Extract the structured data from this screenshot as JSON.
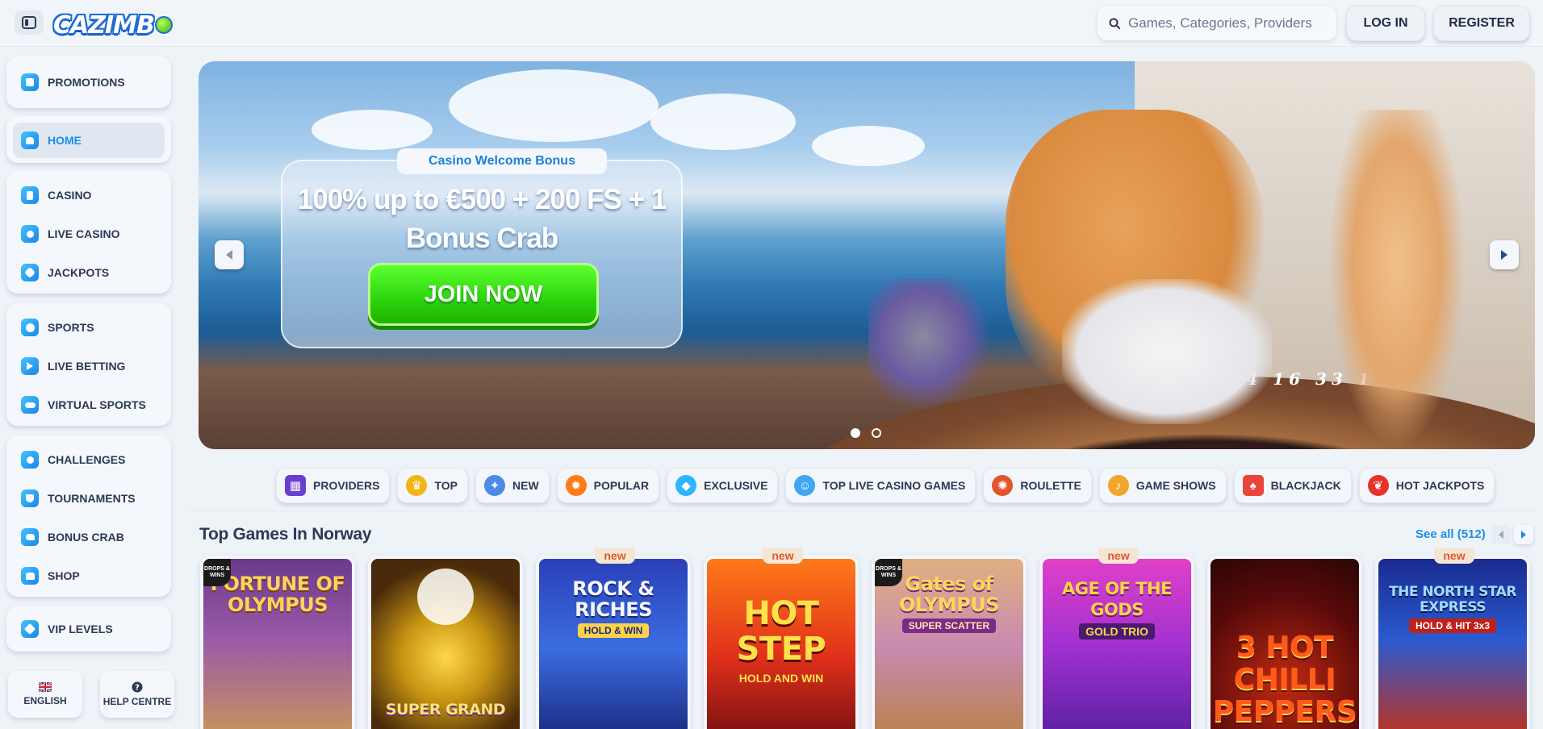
{
  "header": {
    "logo_text": "CAZIMB",
    "search_placeholder": "Games, Categories, Providers",
    "login_label": "LOG IN",
    "register_label": "REGISTER"
  },
  "sidebar": {
    "promotions": "PROMOTIONS",
    "home": "HOME",
    "casino": "CASINO",
    "live_casino": "LIVE CASINO",
    "jackpots": "JACKPOTS",
    "sports": "SPORTS",
    "live_betting": "LIVE BETTING",
    "virtual_sports": "VIRTUAL SPORTS",
    "challenges": "CHALLENGES",
    "tournaments": "TOURNAMENTS",
    "bonus_crab": "BONUS CRAB",
    "shop": "SHOP",
    "vip_levels": "VIP LEVELS",
    "language": "ENGLISH",
    "help": "HELP CENTRE"
  },
  "hero": {
    "tag": "Casino Welcome Bonus",
    "headline": "100% up to €500 + 200 FS + 1 Bonus Crab",
    "cta": "JOIN NOW",
    "roulette_numbers": "23 10 5 24 16 33 1",
    "slide_count": 2,
    "active_slide": 1
  },
  "categories": {
    "providers": "PROVIDERS",
    "top": "TOP",
    "new": "NEW",
    "popular": "POPULAR",
    "exclusive": "EXCLUSIVE",
    "top_live": "TOP LIVE CASINO GAMES",
    "roulette": "ROULETTE",
    "game_shows": "GAME SHOWS",
    "blackjack": "BLACKJACK",
    "hot_jackpots": "HOT JACKPOTS"
  },
  "top_games": {
    "title": "Top Games In Norway",
    "see_all": "See all (512)",
    "new_badge": "new",
    "drops_badge": "DROPS & WINS",
    "games": [
      {
        "title": "FORTUNE OF OLYMPUS",
        "sub": "",
        "is_new": false,
        "drops": true
      },
      {
        "title": "SUPER GRAND",
        "sub": "",
        "is_new": false,
        "drops": false
      },
      {
        "title": "ROCK & RICHES",
        "sub": "HOLD & WIN",
        "is_new": true,
        "drops": false
      },
      {
        "title": "HOT STEP",
        "sub": "HOLD AND WIN",
        "is_new": true,
        "drops": false
      },
      {
        "title": "Gates of OLYMPUS",
        "sub": "SUPER SCATTER",
        "is_new": false,
        "drops": true
      },
      {
        "title": "AGE OF THE GODS",
        "sub": "GOLD TRIO",
        "is_new": true,
        "drops": false
      },
      {
        "title": "3 HOT CHILLI PEPPERS",
        "sub": "",
        "is_new": false,
        "drops": false
      },
      {
        "title": "THE NORTH STAR EXPRESS",
        "sub": "HOLD & HIT 3x3",
        "is_new": true,
        "drops": false
      }
    ]
  },
  "colors": {
    "accent": "#1d8ee8",
    "cta_green": "#2ed80f",
    "new_badge": "#e2592a"
  }
}
